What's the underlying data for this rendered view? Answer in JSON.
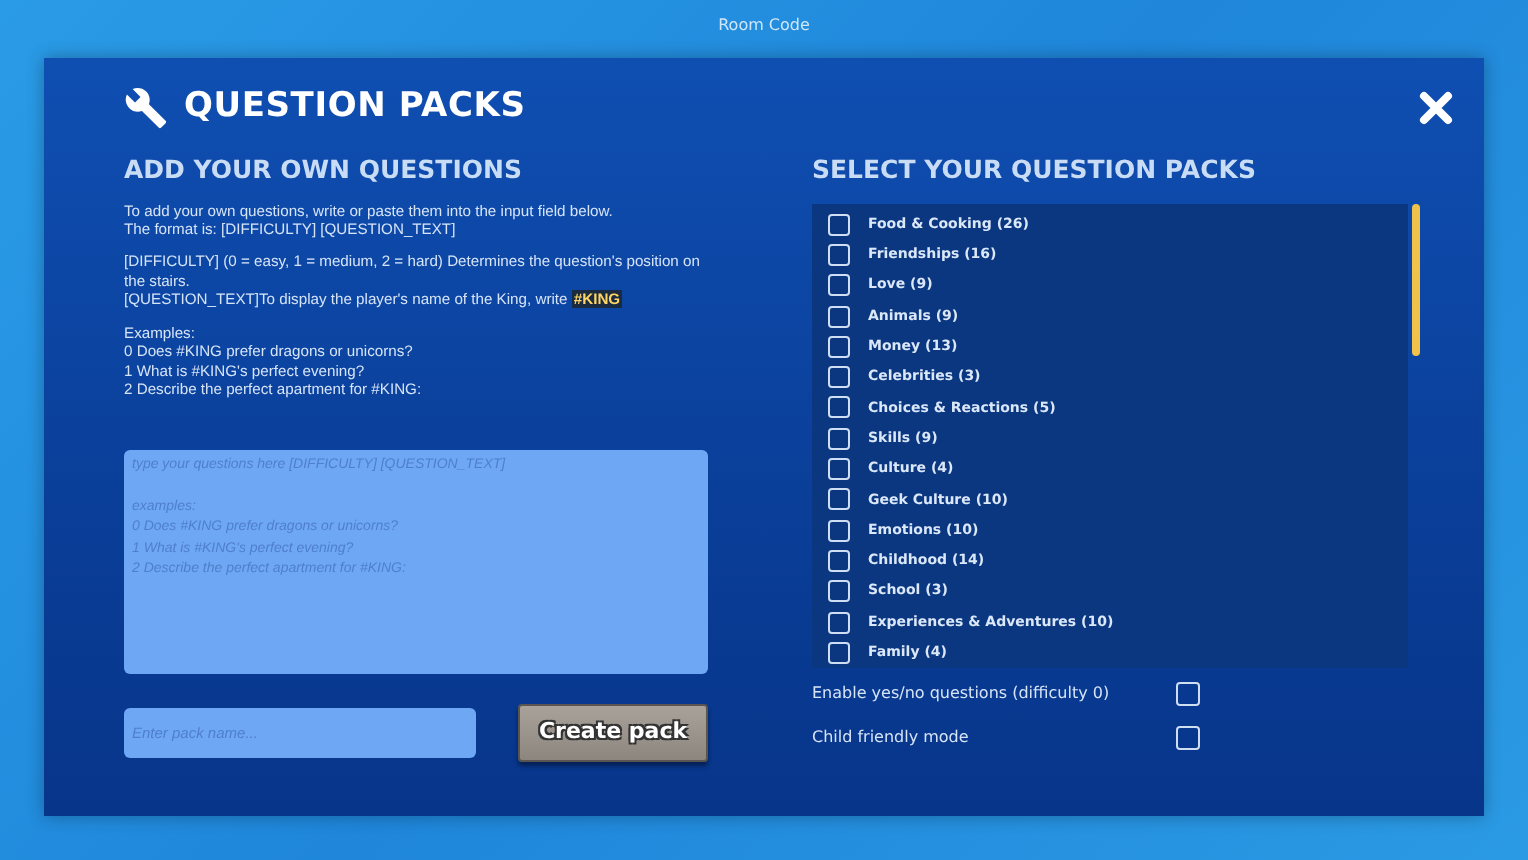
{
  "background": {
    "room_code_label": "Room Code"
  },
  "modal": {
    "title": "QUESTION PACKS",
    "left": {
      "heading": "ADD YOUR OWN QUESTIONS",
      "paragraphs": [
        "To add your own questions, write or paste them into the input field below.\nThe format is: [DIFFICULTY] [QUESTION_TEXT]",
        "[DIFFICULTY] (0 = easy, 1 = medium, 2 = hard) Determines the question's position on the stairs.\n[QUESTION_TEXT]To display the player's name of the King, write **#KING**",
        "Examples:\n0 Does #KING prefer dragons or unicorns?\n1 What is #KING's perfect evening?\n2 Describe the perfect apartment for #KING:"
      ],
      "textarea": {
        "placeholder": "type your questions here [DIFFICULTY] [QUESTION_TEXT]\n\nexamples:\n0 Does #KING prefer dragons or unicorns?\n1 What is #KING's perfect evening?\n2 Describe the perfect apartment for #KING:"
      },
      "pack_name": {
        "placeholder": "Enter pack name..."
      },
      "create_button": "Create pack"
    },
    "right": {
      "heading": "SELECT YOUR QUESTION PACKS",
      "packs": [
        {
          "label": "Food & Cooking (26)",
          "checked": false
        },
        {
          "label": "Friendships (16)",
          "checked": false
        },
        {
          "label": "Love (9)",
          "checked": false
        },
        {
          "label": "Animals (9)",
          "checked": false
        },
        {
          "label": "Money (13)",
          "checked": false
        },
        {
          "label": "Celebrities (3)",
          "checked": false
        },
        {
          "label": "Choices & Reactions (5)",
          "checked": false
        },
        {
          "label": "Skills (9)",
          "checked": false
        },
        {
          "label": "Culture (4)",
          "checked": false
        },
        {
          "label": "Geek Culture (10)",
          "checked": false
        },
        {
          "label": "Emotions (10)",
          "checked": false
        },
        {
          "label": "Childhood (14)",
          "checked": false
        },
        {
          "label": "School (3)",
          "checked": false
        },
        {
          "label": "Experiences & Adventures (10)",
          "checked": false
        },
        {
          "label": "Family (4)",
          "checked": false
        }
      ],
      "options": [
        {
          "label": "Enable yes/no questions (difficulty 0)",
          "checked": false
        },
        {
          "label": "Child friendly mode",
          "checked": false
        }
      ]
    }
  }
}
